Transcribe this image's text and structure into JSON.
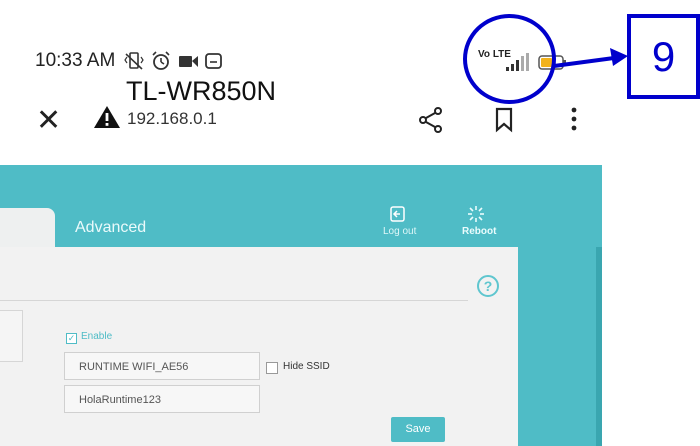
{
  "status_bar": {
    "time": "10:33 AM",
    "network_label": "Vo LTE",
    "icons": [
      "mute-vibrate-icon",
      "alarm-icon",
      "video-icon",
      "screen-icon",
      "signal-icon",
      "battery-icon"
    ]
  },
  "browser": {
    "close_icon": "close-icon",
    "warning_icon": "warning-icon",
    "title": "TL-WR850N",
    "url": "192.168.0.1",
    "actions": [
      "share-icon",
      "bookmark-icon",
      "more-icon"
    ]
  },
  "router": {
    "tabs": {
      "advanced": "Advanced"
    },
    "header_buttons": {
      "logout": "Log out",
      "reboot": "Reboot"
    },
    "help": "?",
    "enable_label": "Enable",
    "ssid_value": "RUNTIME WIFI_AE56",
    "hide_ssid_label": "Hide SSID",
    "password_value": "HolaRuntime123",
    "save_label": "Save"
  },
  "annotation": {
    "number": "9"
  },
  "colors": {
    "teal": "#4fbcc6",
    "annotation_blue": "#0000cc"
  }
}
